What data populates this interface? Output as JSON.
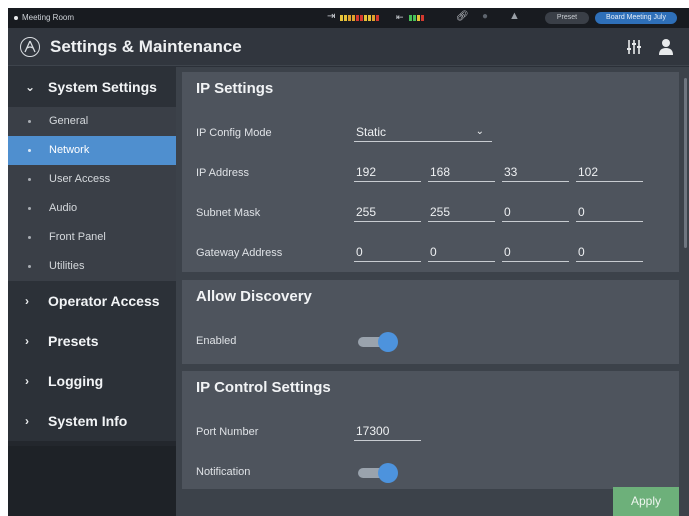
{
  "status_bar": {
    "room_name": "Meeting Room",
    "preset_label": "Preset",
    "preset_value": "Board Meeting July",
    "icons": [
      "input-meter-icon",
      "output-meter-icon",
      "link-icon",
      "mic-mute-icon",
      "warning-icon"
    ],
    "meter_colors": [
      "#e6c23a",
      "#e0a32e",
      "#d4392f",
      "#49c25a"
    ]
  },
  "header": {
    "title": "Settings & Maintenance",
    "logo_icon": "audio-technica-logo",
    "mixer_icon": "mixer-sliders-icon",
    "user_icon": "user-icon"
  },
  "sidebar": {
    "groups": [
      {
        "label": "System Settings",
        "expanded": true,
        "items": [
          {
            "label": "General",
            "active": false
          },
          {
            "label": "Network",
            "active": true
          },
          {
            "label": "User Access",
            "active": false
          },
          {
            "label": "Audio",
            "active": false
          },
          {
            "label": "Front Panel",
            "active": false
          },
          {
            "label": "Utilities",
            "active": false
          }
        ]
      },
      {
        "label": "Operator Access",
        "expanded": false
      },
      {
        "label": "Presets",
        "expanded": false
      },
      {
        "label": "Logging",
        "expanded": false
      },
      {
        "label": "System Info",
        "expanded": false
      }
    ]
  },
  "ip_settings": {
    "title": "IP Settings",
    "config_mode_label": "IP Config Mode",
    "config_mode_value": "Static",
    "ip_address_label": "IP Address",
    "ip_address": [
      "192",
      "168",
      "33",
      "102"
    ],
    "subnet_mask_label": "Subnet Mask",
    "subnet_mask": [
      "255",
      "255",
      "0",
      "0"
    ],
    "gateway_label": "Gateway Address",
    "gateway": [
      "0",
      "0",
      "0",
      "0"
    ]
  },
  "allow_discovery": {
    "title": "Allow Discovery",
    "enabled_label": "Enabled",
    "enabled": true
  },
  "ip_control": {
    "title": "IP Control Settings",
    "port_label": "Port Number",
    "port_value": "17300",
    "notification_label": "Notification",
    "notification": true
  },
  "footer": {
    "apply_label": "Apply"
  },
  "colors": {
    "accent": "#4f8fcf",
    "toggle_on": "#4d93dd",
    "apply": "#6db07a",
    "preset_badge": "#2e6fb8"
  }
}
